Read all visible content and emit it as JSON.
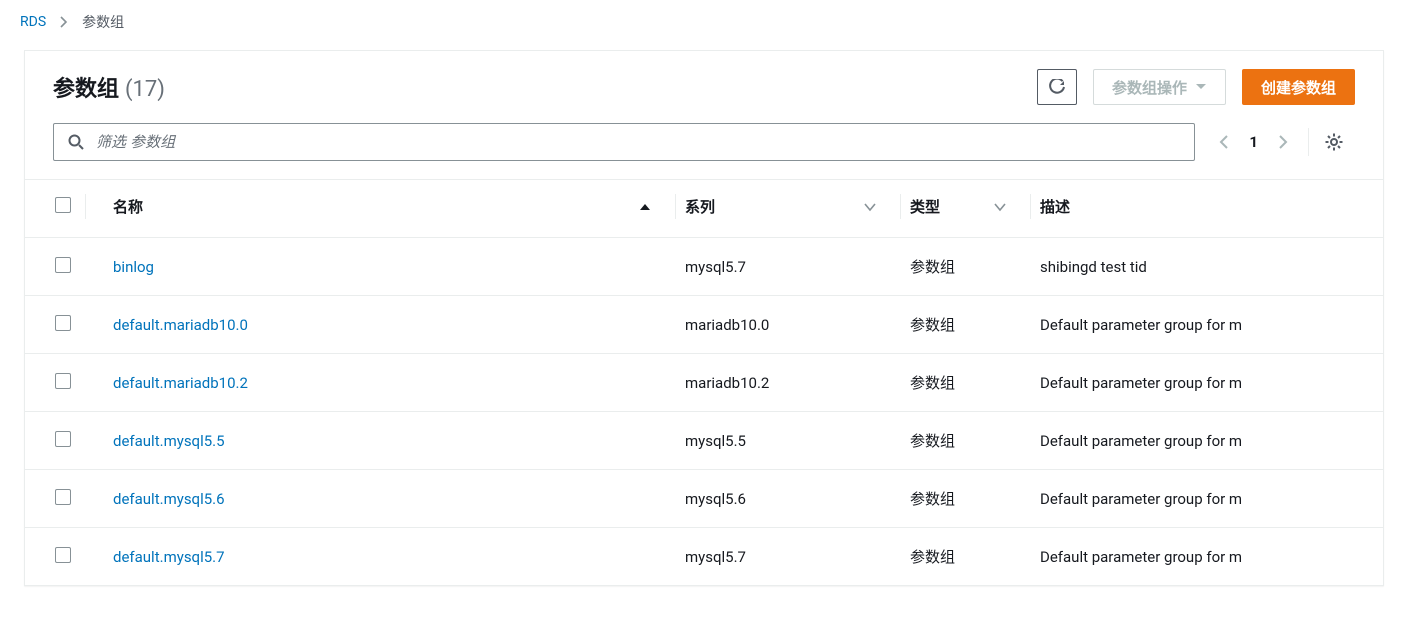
{
  "breadcrumb": {
    "root": "RDS",
    "current": "参数组"
  },
  "header": {
    "title": "参数组",
    "count": "(17)",
    "actions_label": "参数组操作",
    "create_label": "创建参数组"
  },
  "search": {
    "placeholder": "筛选 参数组"
  },
  "pager": {
    "page": "1"
  },
  "columns": {
    "name": "名称",
    "family": "系列",
    "type": "类型",
    "description": "描述"
  },
  "rows": [
    {
      "name": "binlog",
      "family": "mysql5.7",
      "type": "参数组",
      "description": "shibingd test tid"
    },
    {
      "name": "default.mariadb10.0",
      "family": "mariadb10.0",
      "type": "参数组",
      "description": "Default parameter group for m"
    },
    {
      "name": "default.mariadb10.2",
      "family": "mariadb10.2",
      "type": "参数组",
      "description": "Default parameter group for m"
    },
    {
      "name": "default.mysql5.5",
      "family": "mysql5.5",
      "type": "参数组",
      "description": "Default parameter group for m"
    },
    {
      "name": "default.mysql5.6",
      "family": "mysql5.6",
      "type": "参数组",
      "description": "Default parameter group for m"
    },
    {
      "name": "default.mysql5.7",
      "family": "mysql5.7",
      "type": "参数组",
      "description": "Default parameter group for m"
    }
  ]
}
